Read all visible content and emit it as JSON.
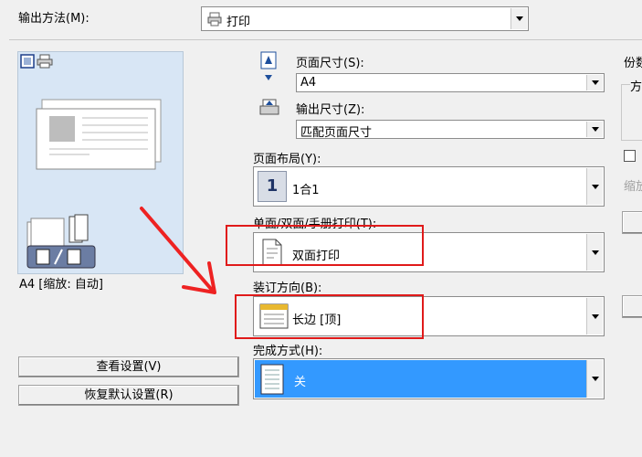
{
  "output": {
    "label": "输出方法(M):",
    "value": "打印"
  },
  "preview": {
    "caption": "A4 [缩放: 自动]"
  },
  "page_size": {
    "label": "页面尺寸(S):",
    "value": "A4"
  },
  "output_size": {
    "label": "输出尺寸(Z):",
    "value": "匹配页面尺寸"
  },
  "layout": {
    "label": "页面布局(Y):",
    "value": "1合1",
    "icon_text": "1"
  },
  "duplex": {
    "label": "单面/双面/手册打印(T):",
    "value": "双面打印"
  },
  "binding": {
    "label": "装订方向(B):",
    "value": "长边 [顶]"
  },
  "finishing": {
    "label": "完成方式(H):",
    "value": "关"
  },
  "buttons": {
    "view_settings": "查看设置(V)",
    "restore_defaults": "恢复默认设置(R)"
  },
  "right_panel": {
    "copies_label": "份数",
    "group_label": "方",
    "zoom_label": "缩放"
  },
  "colors": {
    "selection": "#3399ff",
    "preview_bg": "#d8e6f5",
    "highlight_border": "#e01a1a",
    "arrow": "#ee2222"
  }
}
